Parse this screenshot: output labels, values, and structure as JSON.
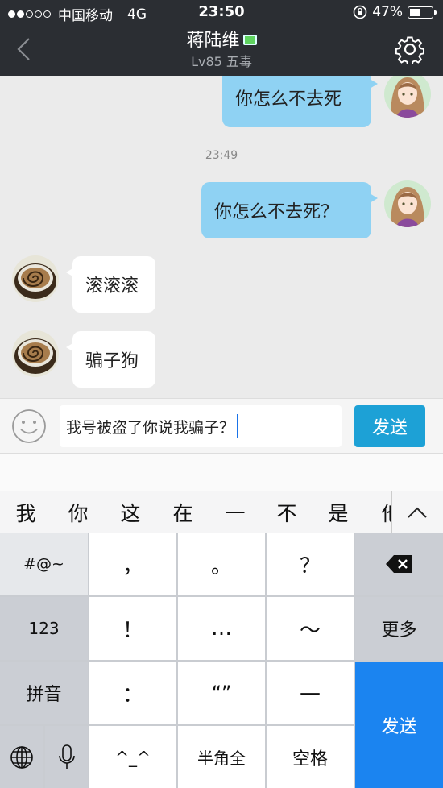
{
  "status_bar": {
    "carrier": "中国移动",
    "network": "4G",
    "time": "23:50",
    "battery": "47%",
    "battery_level": 0.47
  },
  "nav": {
    "title": "蒋陆维",
    "subtitle": "Lv85 五毒",
    "back_icon": "chevron-left-icon",
    "settings_icon": "gear-icon"
  },
  "messages": [
    {
      "side": "out",
      "text": "你怎么不去死"
    },
    {
      "side": "time",
      "text": "23:49"
    },
    {
      "side": "out",
      "text": "你怎么不去死？"
    },
    {
      "side": "in",
      "text": "滚滚滚"
    },
    {
      "side": "in",
      "text": "骗子狗"
    }
  ],
  "input": {
    "value": "我号被盗了你说我骗子？",
    "send_label": "发送"
  },
  "candidates": [
    "我",
    "你",
    "这",
    "在",
    "一",
    "不",
    "是",
    "他"
  ],
  "keyboard": {
    "symbols": "#@~",
    "comma": "，",
    "period": "。",
    "question": "？",
    "num": "123",
    "exclaim": "！",
    "ellipsis": "…",
    "tilde": "～",
    "more": "更多",
    "pinyin": "拼音",
    "colon": "：",
    "quotes": "“”",
    "dash": "—",
    "send": "发送",
    "emoticon": "^_^",
    "halfwidth": "半角全",
    "space": "空格"
  },
  "colors": {
    "nav_bg": "#2b2e33",
    "out_bubble": "#8fd2f3",
    "in_bubble": "#ffffff",
    "send_button": "#1da1d6",
    "keyboard_send": "#1b84f0"
  }
}
